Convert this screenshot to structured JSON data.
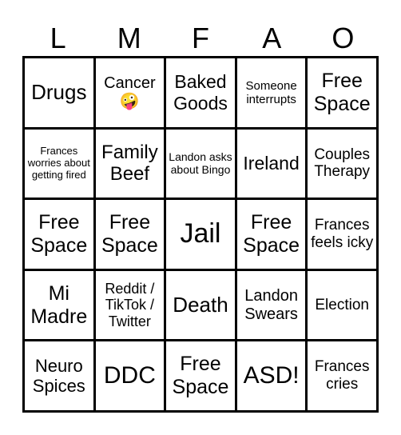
{
  "header": [
    "L",
    "M",
    "F",
    "A",
    "O"
  ],
  "cells": [
    {
      "text": "Drugs",
      "size": 26
    },
    {
      "text": "Cancer\n🤪",
      "size": 20
    },
    {
      "text": "Baked Goods",
      "size": 23
    },
    {
      "text": "Someone interrupts",
      "size": 15
    },
    {
      "text": "Free Space",
      "size": 25
    },
    {
      "text": "Frances worries about getting fired",
      "size": 13
    },
    {
      "text": "Family Beef",
      "size": 24
    },
    {
      "text": "Landon asks about Bingo",
      "size": 14
    },
    {
      "text": "Ireland",
      "size": 23
    },
    {
      "text": "Couples Therapy",
      "size": 19
    },
    {
      "text": "Free Space",
      "size": 25
    },
    {
      "text": "Free Space",
      "size": 25
    },
    {
      "text": "Jail",
      "size": 34
    },
    {
      "text": "Free Space",
      "size": 25
    },
    {
      "text": "Frances feels icky",
      "size": 19
    },
    {
      "text": "Mi Madre",
      "size": 25
    },
    {
      "text": "Reddit / TikTok / Twitter",
      "size": 18
    },
    {
      "text": "Death",
      "size": 26
    },
    {
      "text": "Landon Swears",
      "size": 20
    },
    {
      "text": "Election",
      "size": 19
    },
    {
      "text": "Neuro Spices",
      "size": 22
    },
    {
      "text": "DDC",
      "size": 30
    },
    {
      "text": "Free Space",
      "size": 25
    },
    {
      "text": "ASD!",
      "size": 30
    },
    {
      "text": "Frances cries",
      "size": 19
    }
  ]
}
